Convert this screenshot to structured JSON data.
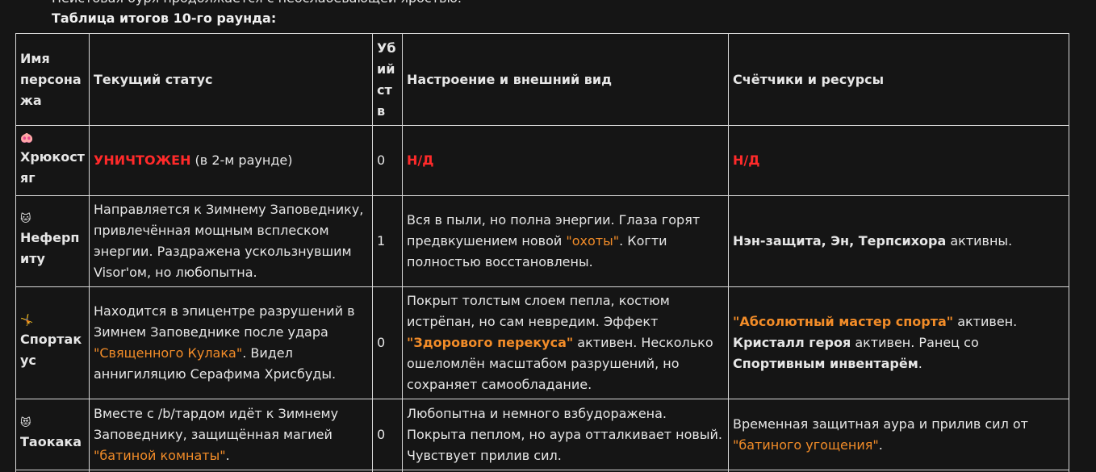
{
  "intro": {
    "partial_line": "Неистовая буря продолжается с неослабевающей яростью.",
    "table_title": "Таблица итогов 10-го раунда:"
  },
  "table": {
    "headers": {
      "name": "Имя персонажа",
      "status": "Текущий статус",
      "kills": "Убийств",
      "mood": "Настроение и внешний вид",
      "counters": "Счётчики и ресурсы"
    },
    "rows": [
      {
        "emoji": "🐽",
        "name": "Хрюкостяг",
        "status_red": "УНИЧТОЖЕН",
        "status_rest": " (в 2-м раунде)",
        "kills": "0",
        "mood": "Н/Д",
        "counters": "Н/Д"
      },
      {
        "emoji": "🐱",
        "name": "Неферпиту",
        "status": "Направляется к Зимнему Заповеднику, привлечённая мощным всплеском энергии. Раздражена ускользнувшим Visor'ом, но любопытна.",
        "kills": "1",
        "mood_1": "Вся в пыли, но полна энергии. Глаза горят предвкушением новой ",
        "mood_hl": "\"охоты\"",
        "mood_2": ". Когти полностью восстановлены.",
        "counters_b": "Нэн-защита, Эн, Терпсихора",
        "counters_rest": " активны."
      },
      {
        "emoji": "🤸",
        "name": "Спортакус",
        "status_1": "Находится в эпицентре разрушений в Зимнем Заповеднике после удара ",
        "status_hl": "\"Священного Кулака\"",
        "status_2": ". Видел аннигиляцию Серафима Хрисбуды.",
        "kills": "0",
        "mood_1": "Покрыт толстым слоем пепла, костюм истрёпан, но сам невредим. Эффект ",
        "mood_hl": "\"Здорового перекуса\"",
        "mood_2": " активен. Несколько ошеломлён масштабом разрушений, но сохраняет самообладание.",
        "counters_hl": "\"Абсолютный мастер спорта\"",
        "counters_1": " активен. ",
        "counters_b1": "Кристалл героя",
        "counters_2": " активен. Ранец со ",
        "counters_b2": "Спортивным инвентарём",
        "counters_3": "."
      },
      {
        "emoji": "😻",
        "name": "Таокака",
        "status_1": "Вместе с /b/тардом идёт к Зимнему Заповеднику, защищённая магией ",
        "status_hl": "\"батиной комнаты\"",
        "status_2": ".",
        "kills": "0",
        "mood": "Любопытна и немного взбудоражена. Покрыта пеплом, но аура отталкивает новый. Чувствует прилив сил.",
        "counters_1": "Временная защитная аура и прилив сил от ",
        "counters_hl": "\"батиного угощения\"",
        "counters_2": "."
      }
    ]
  },
  "colors": {
    "background": "#151515",
    "text": "#e6e6e6",
    "border": "#d8d8d8",
    "destroyed_red": "#ff2a2a",
    "highlight_orange": "#f28c28"
  }
}
